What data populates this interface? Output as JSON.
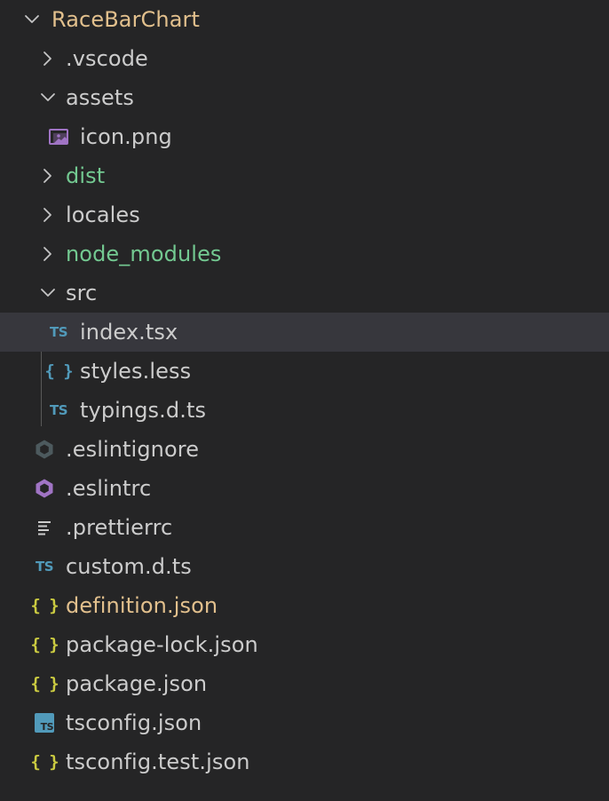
{
  "explorer": {
    "root": {
      "label": "RaceBarChart",
      "color": "#e2c08d"
    },
    "rows": [
      {
        "label": ".vscode",
        "kind": "folder",
        "state": "collapsed",
        "depth": 1,
        "color": "#cccccc"
      },
      {
        "label": "assets",
        "kind": "folder",
        "state": "expanded",
        "depth": 1,
        "color": "#cccccc"
      },
      {
        "label": "icon.png",
        "kind": "file",
        "icon": "image-icon",
        "depth": 2,
        "color": "#cccccc"
      },
      {
        "label": "dist",
        "kind": "folder",
        "state": "collapsed",
        "depth": 1,
        "color": "#73c991"
      },
      {
        "label": "locales",
        "kind": "folder",
        "state": "collapsed",
        "depth": 1,
        "color": "#cccccc"
      },
      {
        "label": "node_modules",
        "kind": "folder",
        "state": "collapsed",
        "depth": 1,
        "color": "#73c991"
      },
      {
        "label": "src",
        "kind": "folder",
        "state": "expanded",
        "depth": 1,
        "color": "#cccccc"
      },
      {
        "label": "index.tsx",
        "kind": "file",
        "icon": "typescript-icon",
        "icon_text": "TS",
        "depth": 2,
        "color": "#cccccc",
        "selected": true
      },
      {
        "label": "styles.less",
        "kind": "file",
        "icon": "less-braces-icon",
        "icon_text": "{ }",
        "depth": 2,
        "color": "#cccccc"
      },
      {
        "label": "typings.d.ts",
        "kind": "file",
        "icon": "typescript-icon",
        "icon_text": "TS",
        "depth": 2,
        "color": "#cccccc"
      },
      {
        "label": ".eslintignore",
        "kind": "file",
        "icon": "eslintignore-icon",
        "depth": 1,
        "color": "#cccccc"
      },
      {
        "label": ".eslintrc",
        "kind": "file",
        "icon": "eslint-icon",
        "depth": 1,
        "color": "#cccccc"
      },
      {
        "label": ".prettierrc",
        "kind": "file",
        "icon": "lines-icon",
        "depth": 1,
        "color": "#cccccc"
      },
      {
        "label": "custom.d.ts",
        "kind": "file",
        "icon": "typescript-icon",
        "icon_text": "TS",
        "depth": 1,
        "color": "#cccccc"
      },
      {
        "label": "definition.json",
        "kind": "file",
        "icon": "json-braces-icon",
        "icon_text": "{ }",
        "depth": 1,
        "color": "#e2c08d"
      },
      {
        "label": "package-lock.json",
        "kind": "file",
        "icon": "json-braces-icon",
        "icon_text": "{ }",
        "depth": 1,
        "color": "#cccccc"
      },
      {
        "label": "package.json",
        "kind": "file",
        "icon": "json-braces-icon",
        "icon_text": "{ }",
        "depth": 1,
        "color": "#cccccc"
      },
      {
        "label": "tsconfig.json",
        "kind": "file",
        "icon": "tsconfig-icon",
        "icon_text": "TS",
        "depth": 1,
        "color": "#cccccc"
      },
      {
        "label": "tsconfig.test.json",
        "kind": "file",
        "icon": "json-braces-icon",
        "icon_text": "{ }",
        "depth": 1,
        "color": "#cccccc"
      }
    ]
  },
  "colors": {
    "background": "#252526",
    "selection": "#37373d",
    "chevron": "#c5c5c5",
    "ts_blue": "#519aba",
    "json_yellow": "#cbcb41",
    "image_purple": "#a074c4",
    "eslint_purple": "#a074c4",
    "eslintignore_gray": "#4d5a5e",
    "lines_gray": "#cccccc"
  }
}
